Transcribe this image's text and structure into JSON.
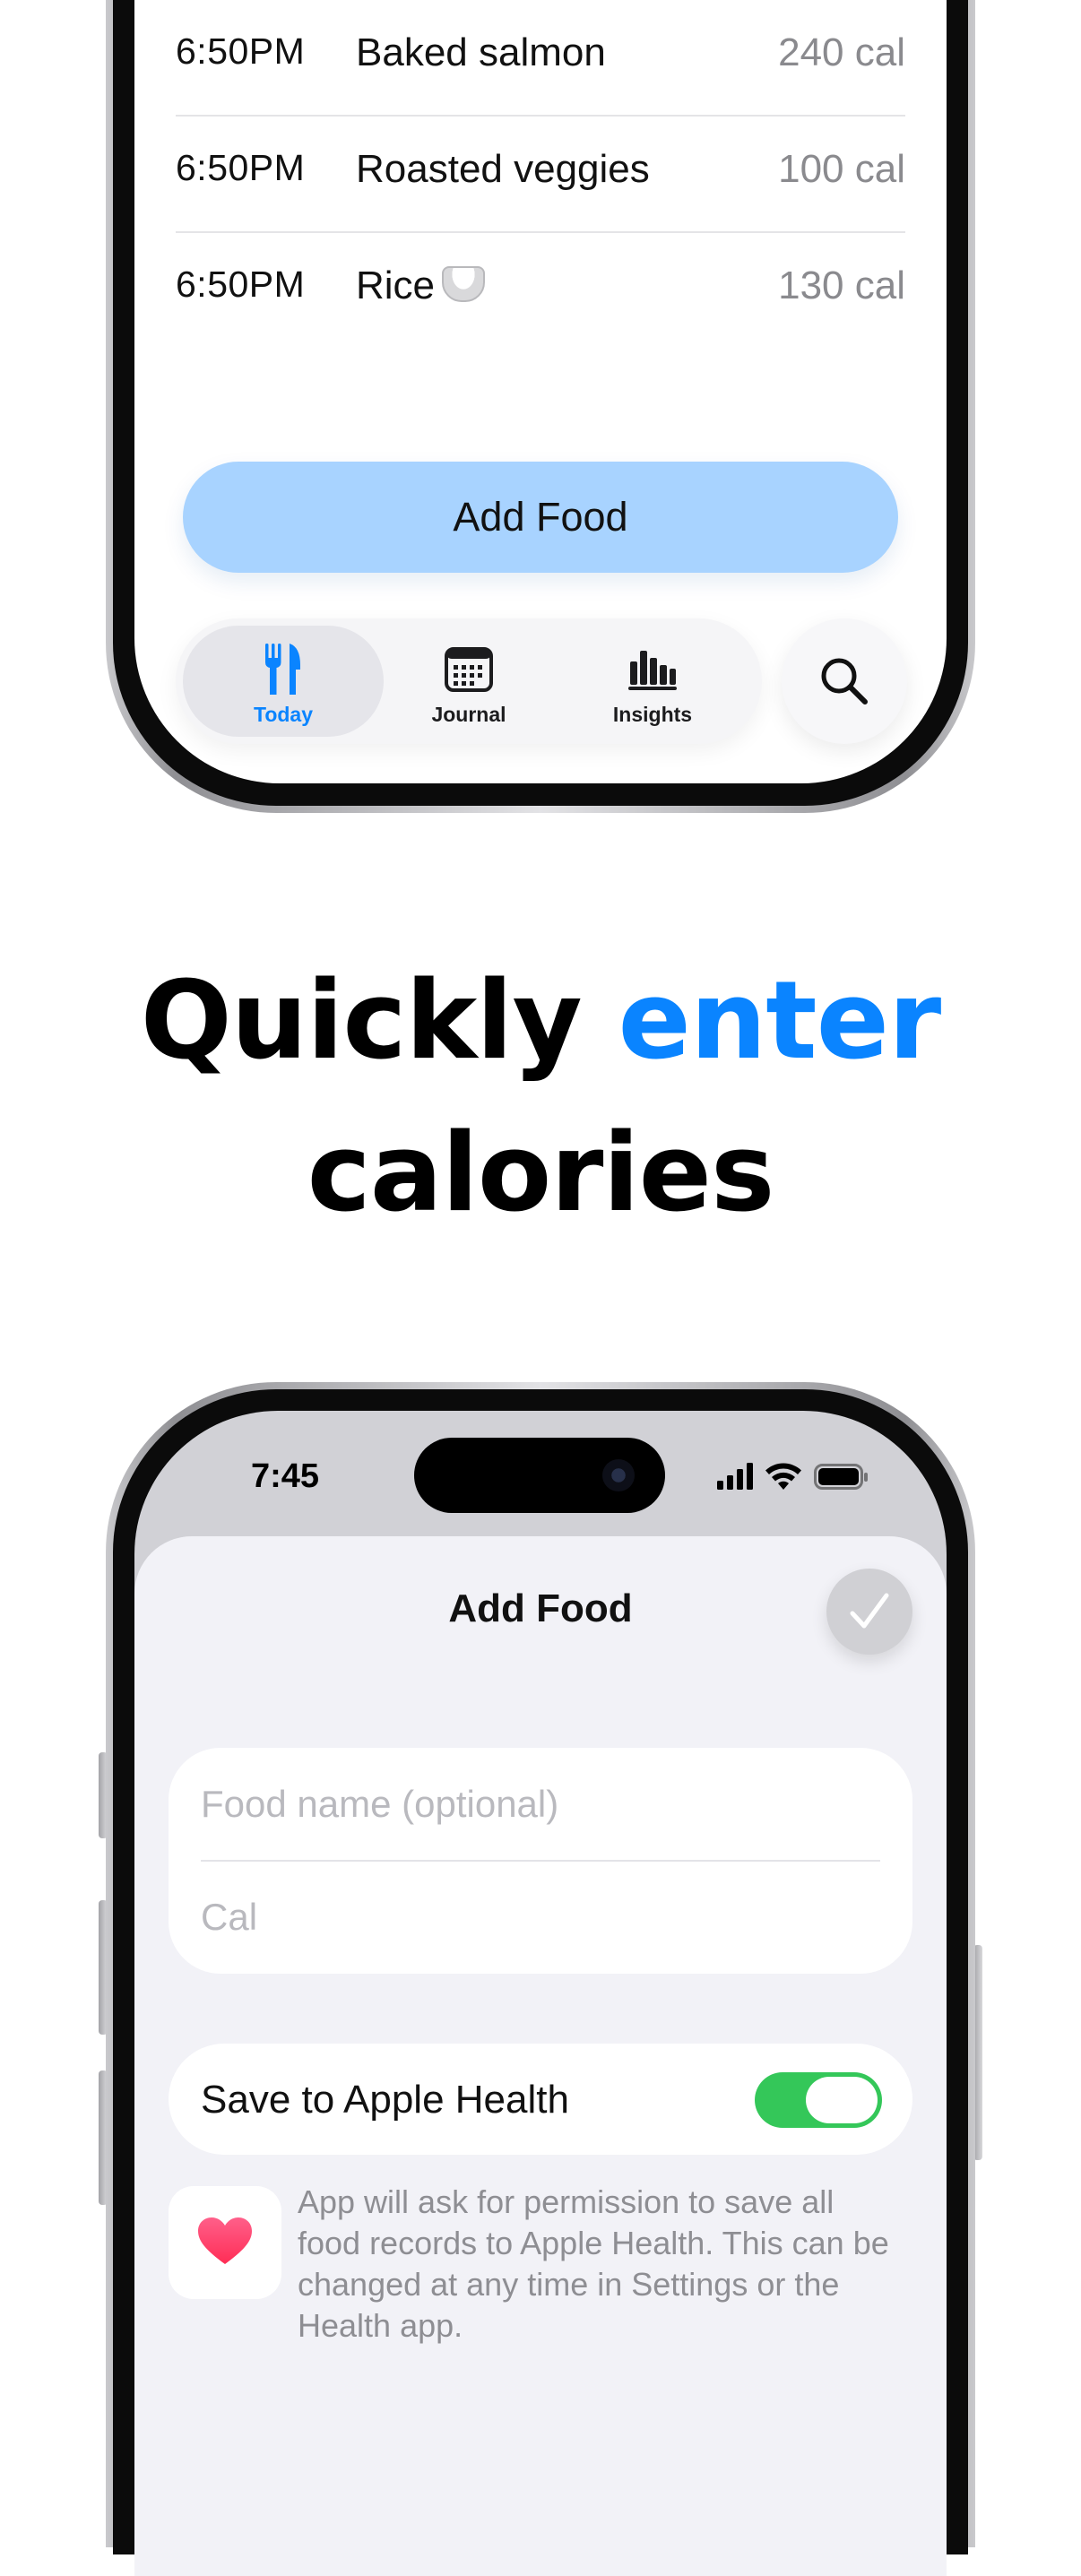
{
  "top_phone": {
    "entries": [
      {
        "time": "6:50PM",
        "name": "Baked salmon",
        "calories": "240 cal"
      },
      {
        "time": "6:50PM",
        "name": "Roasted veggies",
        "calories": "100 cal"
      },
      {
        "time": "6:50PM",
        "name": "Rice",
        "calories": "130 cal"
      }
    ],
    "add_food_label": "Add Food",
    "tabs": [
      {
        "label": "Today",
        "icon": "fork-knife-icon",
        "active": true
      },
      {
        "label": "Journal",
        "icon": "calendar-icon",
        "active": false
      },
      {
        "label": "Insights",
        "icon": "bar-chart-icon",
        "active": false
      }
    ],
    "search_icon": "search-icon"
  },
  "headline": {
    "word1": "Quickly",
    "accent": "enter",
    "word2": "calories"
  },
  "colors": {
    "accent": "#0a84ff",
    "add_button": "#a8d3ff",
    "toggle_on": "#34c759",
    "heart": "#ff3b5c"
  },
  "bottom_phone": {
    "status": {
      "time": "7:45"
    },
    "sheet": {
      "title": "Add Food",
      "confirm_icon": "checkmark-icon",
      "food_name_placeholder": "Food name (optional)",
      "food_name_value": "",
      "cal_placeholder": "Cal",
      "cal_value": "",
      "health_label": "Save to Apple Health",
      "health_toggle_on": true,
      "health_note": "App will ask for permission to save all food records to Apple Health. This can be changed at any time in Settings or the Health app."
    }
  }
}
